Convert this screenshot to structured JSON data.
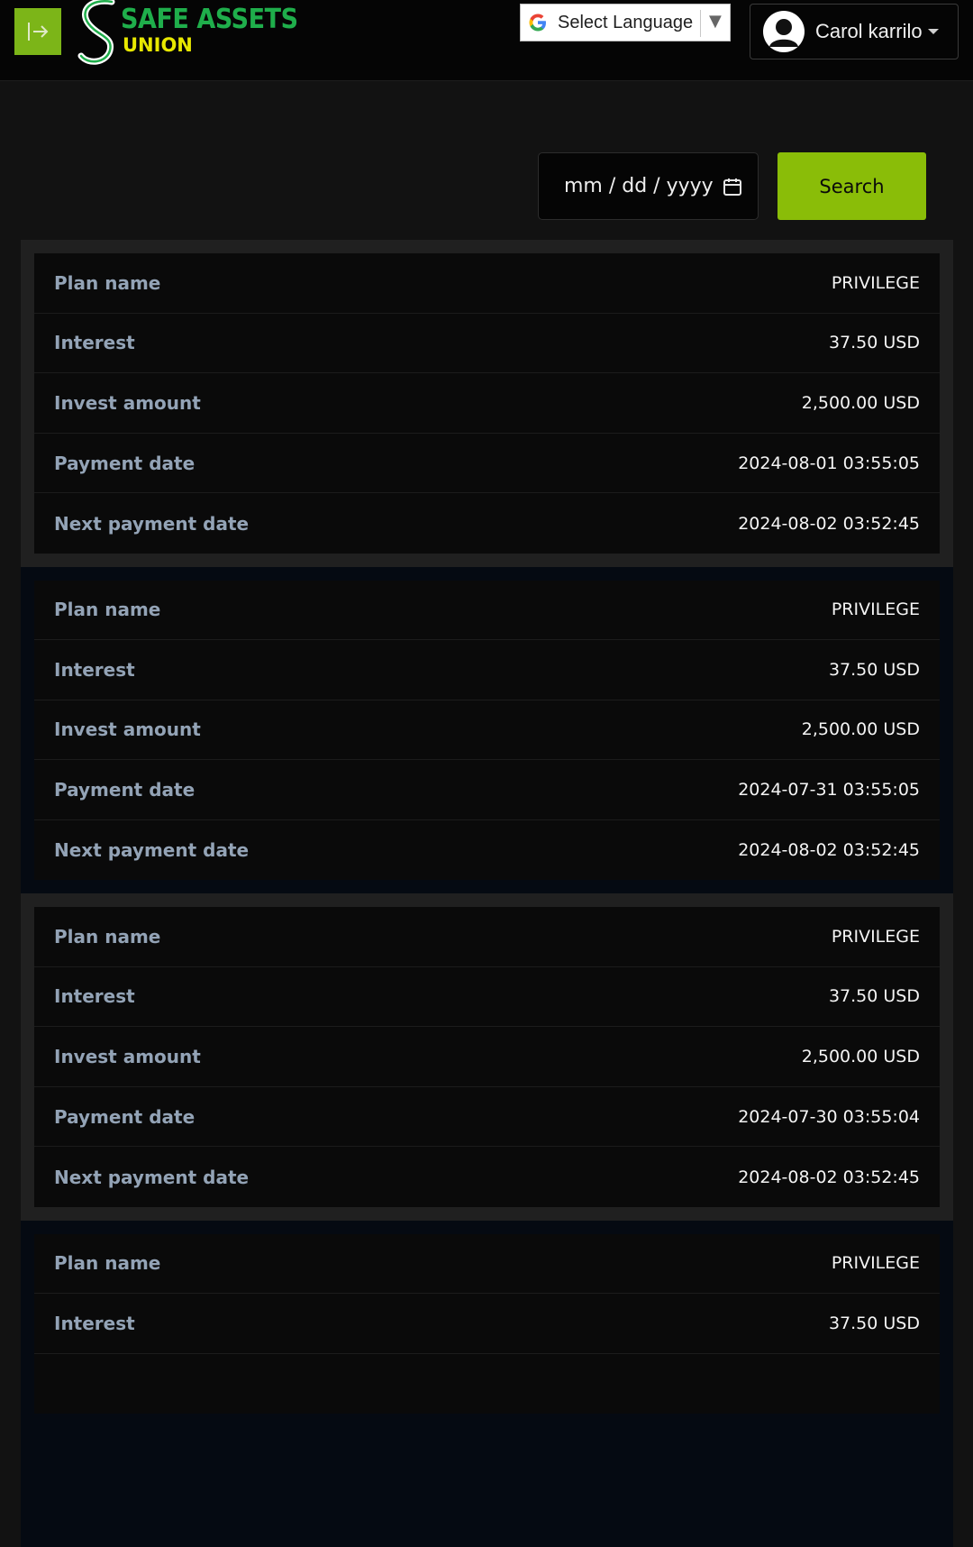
{
  "header": {
    "brand_line1": "SAFE ASSETS",
    "brand_line2": "UNION",
    "language_select_label": "Select Language",
    "user_name": "Carol karrilo",
    "icons": [
      "sidebar-toggle-icon",
      "google-icon",
      "dropdown-arrow-icon",
      "user-avatar-icon",
      "caret-down-icon"
    ]
  },
  "filter": {
    "date_placeholder": "mm / dd / yyyy",
    "search_label": "Search",
    "icons": [
      "calendar-icon"
    ]
  },
  "colors": {
    "accent": "#8abd08",
    "toggle": "#7cb518",
    "brand_green": "#1fae4b",
    "brand_yellow": "#e8e800",
    "label": "#93a3b6"
  },
  "records": [
    {
      "rows": [
        {
          "label": "Plan name",
          "value": "PRIVILEGE"
        },
        {
          "label": "Interest",
          "value": "37.50 USD"
        },
        {
          "label": "Invest amount",
          "value": "2,500.00 USD"
        },
        {
          "label": "Payment date",
          "value": "2024-08-01 03:55:05"
        },
        {
          "label": "Next payment date",
          "value": "2024-08-02 03:52:45"
        }
      ]
    },
    {
      "rows": [
        {
          "label": "Plan name",
          "value": "PRIVILEGE"
        },
        {
          "label": "Interest",
          "value": "37.50 USD"
        },
        {
          "label": "Invest amount",
          "value": "2,500.00 USD"
        },
        {
          "label": "Payment date",
          "value": "2024-07-31 03:55:05"
        },
        {
          "label": "Next payment date",
          "value": "2024-08-02 03:52:45"
        }
      ]
    },
    {
      "rows": [
        {
          "label": "Plan name",
          "value": "PRIVILEGE"
        },
        {
          "label": "Interest",
          "value": "37.50 USD"
        },
        {
          "label": "Invest amount",
          "value": "2,500.00 USD"
        },
        {
          "label": "Payment date",
          "value": "2024-07-30 03:55:04"
        },
        {
          "label": "Next payment date",
          "value": "2024-08-02 03:52:45"
        }
      ]
    },
    {
      "rows": [
        {
          "label": "Plan name",
          "value": "PRIVILEGE"
        },
        {
          "label": "Interest",
          "value": "37.50 USD"
        }
      ]
    }
  ]
}
